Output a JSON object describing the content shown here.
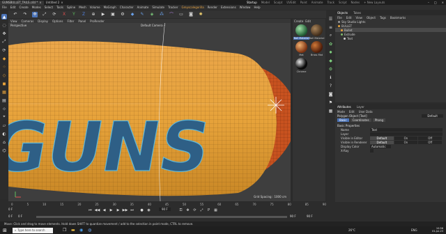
{
  "titlebar": {
    "tabs": [
      {
        "label": "GUNSBULLET_TAILS.c4d *"
      },
      {
        "label": "Untitled 2"
      }
    ],
    "layouts": [
      "Startup",
      "Model",
      "Sculpt",
      "UVEdit",
      "Paint",
      "Animate",
      "Track",
      "Script",
      "Nodes"
    ],
    "active_layout": "Startup",
    "new_layouts": "+ New Layouts"
  },
  "menubar": {
    "items": [
      "File",
      "Edit",
      "Create",
      "Modes",
      "Select",
      "Tools",
      "Spline",
      "Mesh",
      "Volume",
      "MoGraph",
      "Character",
      "Animate",
      "Simulate",
      "Tracker",
      "Render",
      "Extensions",
      "Window",
      "Help"
    ],
    "extension_item": "Greyscalegorilla"
  },
  "viewport": {
    "menu": [
      "View",
      "Cameras",
      "Display",
      "Options",
      "Filter",
      "Panel",
      "ProRender"
    ],
    "perspective_label": "Perspective",
    "camera_label": "Default Camera •",
    "grid_label": "Grid Spacing : 1000 cm",
    "text": "GUNS"
  },
  "materials": {
    "menu": [
      "Create",
      "Edit",
      "View",
      "Select",
      "Material",
      "Texture"
    ],
    "items": [
      {
        "label": "Ball Material",
        "color_a": "#9fe0a6",
        "color_b": "#1f5b33",
        "selected": true
      },
      {
        "label": "Ball Material",
        "color_a": "#a8845a",
        "color_b": "#3e2a18",
        "selected": false
      },
      {
        "label": "Mat",
        "color_a": "#f0b070",
        "color_b": "#7a3010",
        "selected": false
      },
      {
        "label": "Brass Mat",
        "color_a": "#d07838",
        "color_b": "#4a1a08",
        "selected": false
      },
      {
        "label": "Chrome",
        "color_a": "#e8e8e8",
        "color_b": "#0a0a0a",
        "selected": false
      }
    ]
  },
  "objects": {
    "tabs": [
      "Objects",
      "Takes"
    ],
    "menu": [
      "File",
      "Edit",
      "View",
      "Object",
      "Tags",
      "Bookmarks"
    ],
    "rows": [
      {
        "label": "Sky Studio Lights",
        "color": "#9a9a9a",
        "selected": false
      },
      {
        "label": "BULLET",
        "color": "#e7a33b",
        "selected": false
      },
      {
        "label": "Bullet",
        "color": "#e7a33b",
        "selected": true
      },
      {
        "label": "Extrude",
        "color": "#7fb86b",
        "selected": false
      },
      {
        "label": "Text",
        "color": "#cfcfcf",
        "selected": false
      }
    ]
  },
  "attributes": {
    "tabs": [
      "Attributes",
      "Layer"
    ],
    "menu": [
      "Mode",
      "Edit",
      "User Data"
    ],
    "object_title": "Polygon Object [Text]",
    "preset_label": "Default",
    "buttons": [
      "Basic",
      "Coordinates",
      "Phong"
    ],
    "active_button": "Basic",
    "section": "Basic Properties",
    "name_label": "Name",
    "name_value": "Text",
    "layer_label": "Layer",
    "visible_editor_label": "Visible in Editor",
    "visible_renderer_label": "Visible in Renderer",
    "options": [
      "Default",
      "On",
      "Off"
    ],
    "use_color_label": "Display Color",
    "use_color_value": "Automatic",
    "xray_label": "X-Ray"
  },
  "timeline": {
    "ticks": [
      "0",
      "5",
      "10",
      "15",
      "20",
      "25",
      "30",
      "35",
      "40",
      "45",
      "50",
      "55",
      "60",
      "65",
      "70",
      "75",
      "80",
      "85",
      "90"
    ],
    "current_frame": "0 F",
    "start_frame": "0 F",
    "end_frame": "90 F",
    "min_frame": "0 F",
    "max_frame": "90 F"
  },
  "statusbar": {
    "text": "Move: Click and drag to move elements. Hold down SHIFT to quantize movement / add to the selection in point mode, CTRL to remove."
  },
  "taskbar": {
    "search_placeholder": "Type here to search",
    "weather": "26°C",
    "time": "10:56",
    "date": "01-Jul-23",
    "language": "ENG"
  },
  "colors": {
    "accent": "#4c74b8",
    "bullet_orange": "#e7a33b",
    "casing_brass": "#c7521f",
    "wireframe": "#5fb7d8"
  }
}
